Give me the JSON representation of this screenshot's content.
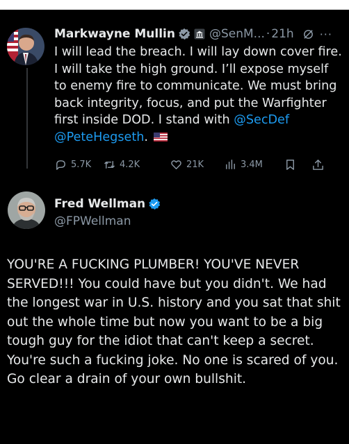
{
  "tweet1": {
    "name": "Markwayne Mullin",
    "handle": "@SenM...",
    "separator": "·",
    "time": "21h",
    "more": "···",
    "body_prefix": "I will lead the breach. I will lay down cover fire. I will take the high ground. I’ll expose myself to enemy fire to communicate. We must bring back integrity, focus, and put the Warfighter first inside DOD. I stand with ",
    "mention1": "@SecDef",
    "mention2": "@PeteHegseth",
    "body_suffix": ".",
    "stats": {
      "replies": "5.7K",
      "reposts": "4.2K",
      "likes": "21K",
      "views": "3.4M"
    }
  },
  "tweet2": {
    "name": "Fred Wellman",
    "handle": "@FPWellman",
    "body": "YOU'RE A FUCKING PLUMBER! YOU'VE NEVER SERVED!!! You could have but you didn't.  We had the longest war in U.S. history and you sat that shit out the whole time but now you want to be a big tough guy for the idiot that can't keep a secret. You're such a fucking joke. No one is scared of you. Go clear a drain of your own bullshit."
  },
  "colors": {
    "background": "#000000",
    "text": "#e7e9ea",
    "secondary": "#8b98a5",
    "link": "#1d9bf0"
  }
}
